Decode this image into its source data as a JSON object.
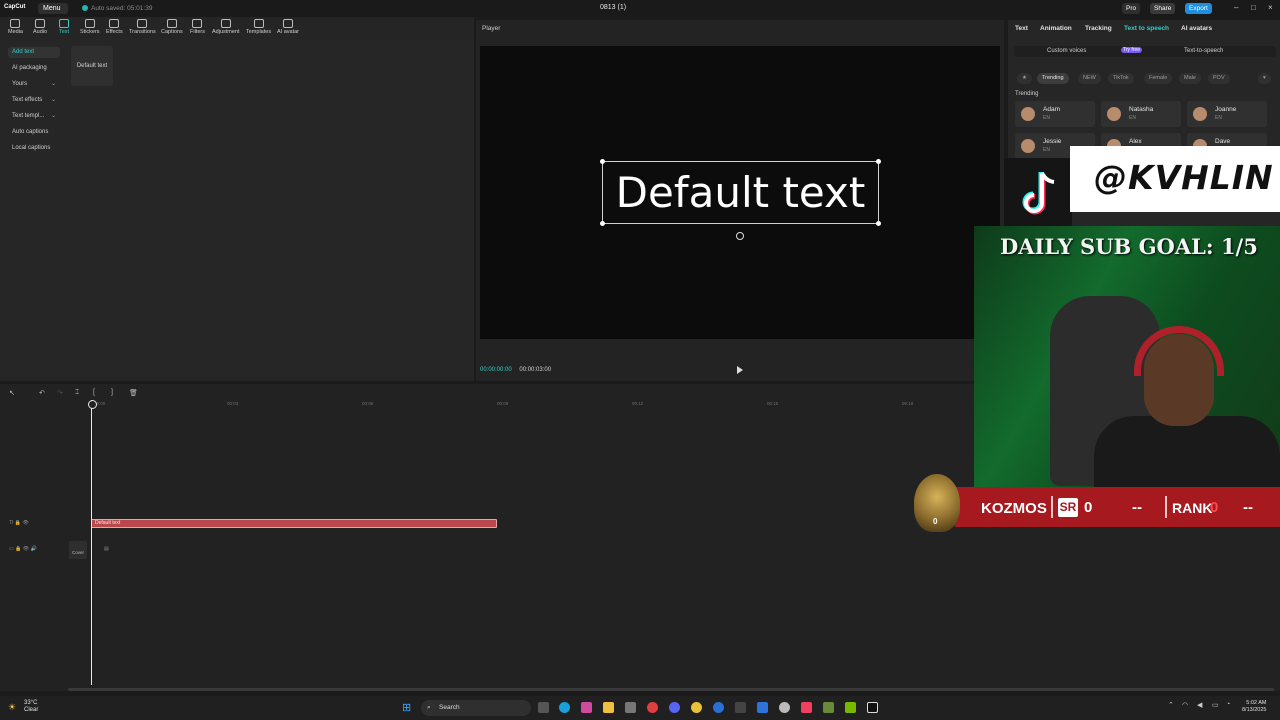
{
  "titlebar": {
    "logo": "CapCut",
    "menu": "Menu",
    "autosave": "Auto saved: 05:01:39",
    "project_title": "0813 (1)",
    "pro": "Pro",
    "share": "Share",
    "export": "Export"
  },
  "tools": [
    {
      "label": "Media"
    },
    {
      "label": "Audio"
    },
    {
      "label": "Text"
    },
    {
      "label": "Stickers"
    },
    {
      "label": "Effects"
    },
    {
      "label": "Transitions"
    },
    {
      "label": "Captions"
    },
    {
      "label": "Filters"
    },
    {
      "label": "Adjustment"
    },
    {
      "label": "Templates"
    },
    {
      "label": "AI avatar"
    }
  ],
  "left_categories": [
    {
      "label": "Add text"
    },
    {
      "label": "AI packaging"
    },
    {
      "label": "Yours"
    },
    {
      "label": "Text effects"
    },
    {
      "label": "Text templ..."
    },
    {
      "label": "Auto captions"
    },
    {
      "label": "Local captions"
    }
  ],
  "default_tile": "Default text",
  "player": {
    "label": "Player",
    "canvas_text": "Default text",
    "time_current": "00:00:00:00",
    "time_total": "00:00:03:00"
  },
  "right_panel": {
    "tabs": [
      "Text",
      "Animation",
      "Tracking",
      "Text to speech",
      "AI avatars"
    ],
    "sub_tabs": [
      "Custom voices",
      "Try free",
      "Text-to-speech"
    ],
    "filters": [
      "Trending",
      "NEW",
      "TikTok",
      "Female",
      "Male",
      "POV"
    ],
    "trending_heading": "Trending",
    "voices": [
      {
        "name": "Adam",
        "lang": "EN"
      },
      {
        "name": "Natasha",
        "lang": "EN"
      },
      {
        "name": "Joanne",
        "lang": "EN"
      },
      {
        "name": "Jessie",
        "lang": "EN"
      },
      {
        "name": "Alex",
        "lang": "EN"
      },
      {
        "name": "Dave",
        "lang": "EN"
      }
    ]
  },
  "timeline": {
    "ruler": [
      "00:00",
      "00:03",
      "00:06",
      "00:09",
      "00:12",
      "00:15",
      "00:18"
    ],
    "clip_label": "Default text",
    "cover_label": "Cover"
  },
  "overlay": {
    "handle": "@KVHLIN",
    "goal": "DAILY SUB GOAL: 1/5",
    "name": "KOZMOS",
    "sr_label": "SR",
    "sr_value": "0",
    "dash1": "--",
    "rank_label": "RANK",
    "rank_value": "0",
    "dash2": "--",
    "badge_value": "0"
  },
  "taskbar": {
    "temp": "33°C",
    "condition": "Clear",
    "search": "Search",
    "time": "5:02 AM",
    "date": "8/13/2025"
  }
}
